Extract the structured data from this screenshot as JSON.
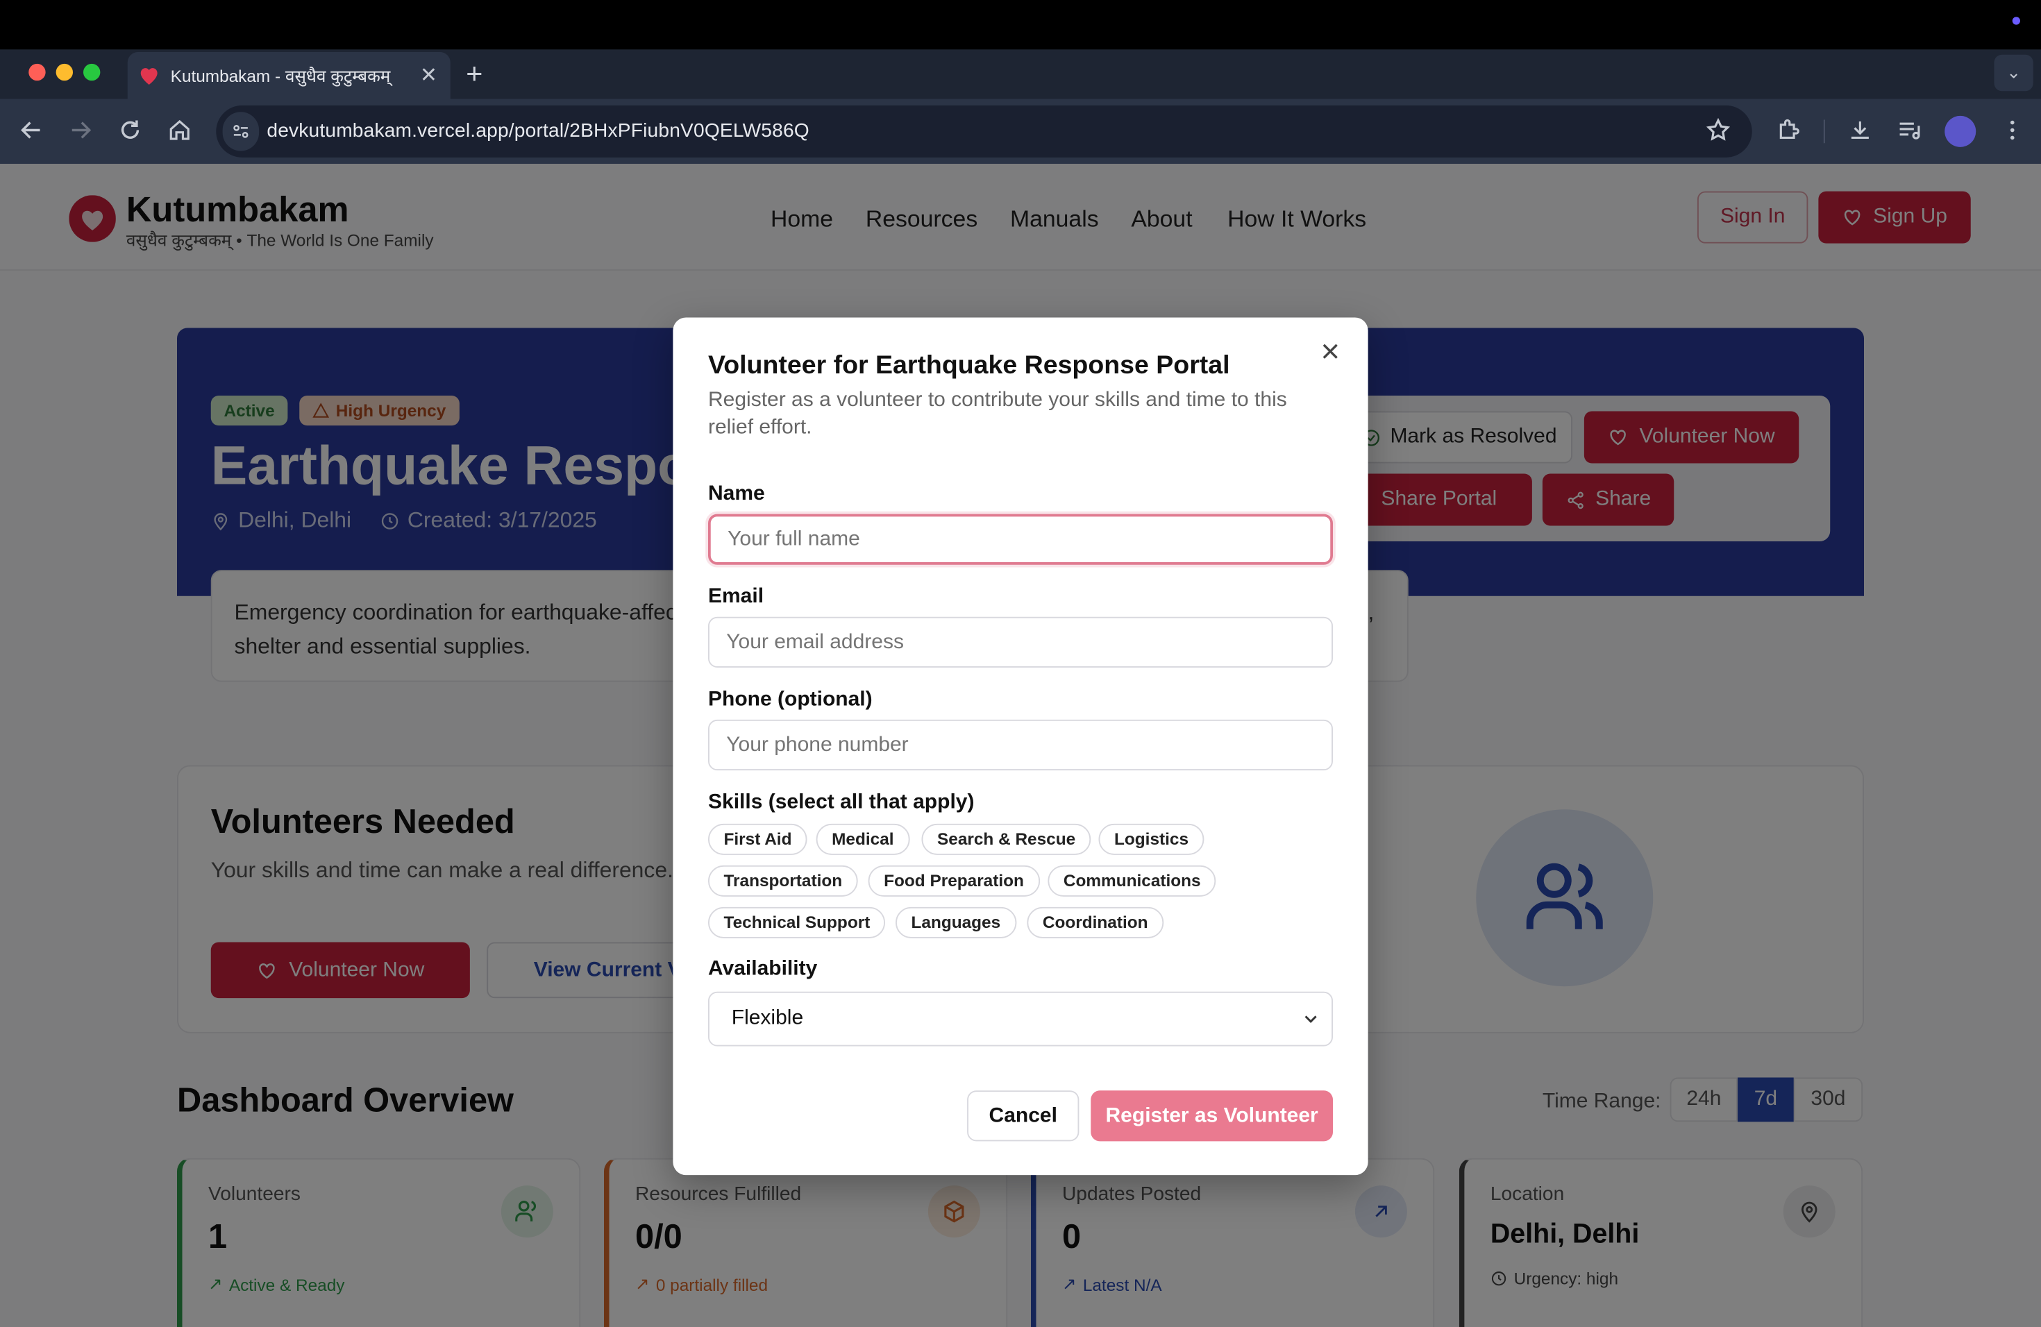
{
  "browser": {
    "tab_title": "Kutumbakam - वसुधैव कुटुम्बकम्",
    "url": "devkutumbakam.vercel.app/portal/2BHxPFiubnV0QELW586Q"
  },
  "site": {
    "name": "Kutumbakam",
    "tagline": "वसुधैव कुटुम्बकम् • The World Is One Family",
    "nav": [
      "Home",
      "Resources",
      "Manuals",
      "About",
      "How It Works"
    ],
    "sign_in": "Sign In",
    "sign_up": "Sign Up"
  },
  "portal": {
    "badge_active": "Active",
    "badge_urgency": "High Urgency",
    "title": "Earthquake Response Portal",
    "location": "Delhi, Delhi",
    "created": "Created: 3/17/2025",
    "actions": {
      "mark_resolved": "Mark as Resolved",
      "volunteer_now": "Volunteer Now",
      "share_portal": "Share Portal",
      "share": "Share"
    },
    "description": "Emergency coordination for earthquake-affected areas in Delhi. Coordinating rescue operations, medical assistance, shelter and essential supplies."
  },
  "volunteers_section": {
    "title": "Volunteers Needed",
    "text": "Your skills and time can make a real difference. 1 volunteer has registered.",
    "volunteer_btn": "Volunteer Now",
    "view_btn": "View Current Volunteers"
  },
  "dashboard": {
    "title": "Dashboard Overview",
    "time_range_label": "Time Range:",
    "ranges": [
      "24h",
      "7d",
      "30d"
    ],
    "selected_range": "7d",
    "stats": [
      {
        "label": "Volunteers",
        "value": "1",
        "sub": "Active & Ready",
        "color": "#2e9a4a"
      },
      {
        "label": "Resources Fulfilled",
        "value": "0/0",
        "sub": "0 partially filled",
        "color": "#d9682a"
      },
      {
        "label": "Updates Posted",
        "value": "0",
        "sub": "Latest N/A",
        "color": "#2a4ab0"
      },
      {
        "label": "Location",
        "value": "Delhi, Delhi",
        "sub": "Urgency: high",
        "color": "#444444"
      }
    ]
  },
  "modal": {
    "title": "Volunteer for Earthquake Response Portal",
    "subtitle": "Register as a volunteer to contribute your skills and time to this relief effort.",
    "name_label": "Name",
    "name_placeholder": "Your full name",
    "email_label": "Email",
    "email_placeholder": "Your email address",
    "phone_label": "Phone (optional)",
    "phone_placeholder": "Your phone number",
    "skills_label": "Skills (select all that apply)",
    "skills": [
      "First Aid",
      "Medical",
      "Search & Rescue",
      "Logistics",
      "Transportation",
      "Food Preparation",
      "Communications",
      "Technical Support",
      "Languages",
      "Coordination"
    ],
    "availability_label": "Availability",
    "availability_value": "Flexible",
    "cancel": "Cancel",
    "submit": "Register as Volunteer"
  },
  "colors": {
    "brand_red": "#c8213c",
    "hero_blue": "#2a3a9c",
    "accent_pink": "#ea7a90"
  }
}
